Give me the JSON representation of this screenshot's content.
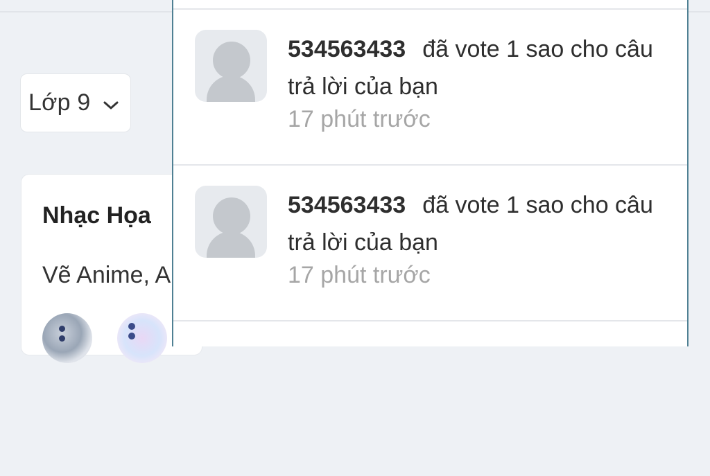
{
  "grade_select": {
    "label": "Lớp 9"
  },
  "card": {
    "title": "Nhạc Họa",
    "subtitle": "Vẽ Anime, A"
  },
  "notifications": [
    {
      "user": "534563433",
      "message": "đã vote 1 sao cho câu trả lời của bạn",
      "time": "17 phút trước"
    },
    {
      "user": "534563433",
      "message": "đã vote 1 sao cho câu trả lời của bạn",
      "time": "17 phút trước"
    }
  ],
  "colors": {
    "panel_border": "#4f8093",
    "background": "#eef1f5",
    "time_text": "#a6a6a6"
  }
}
